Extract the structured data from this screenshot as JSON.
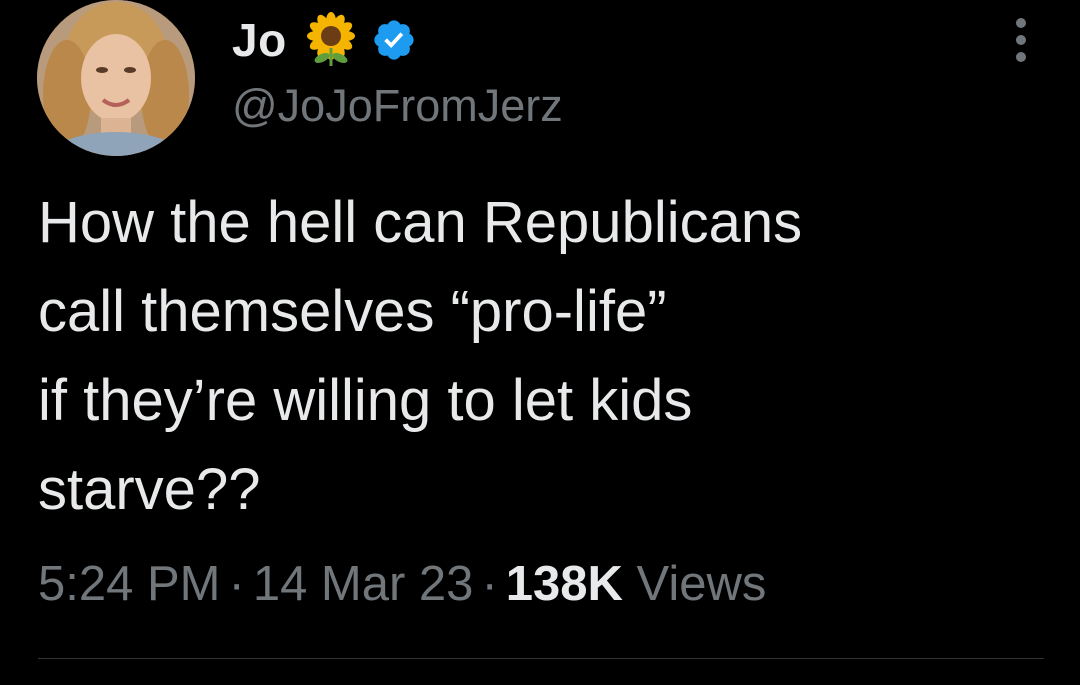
{
  "author": {
    "display_name": "Jo",
    "handle": "@JoJoFromJerz",
    "name_emoji": "sunflower-icon",
    "verified_color": "#1d9bf0"
  },
  "tweet": {
    "lines": [
      "How the hell can Republicans",
      "call themselves “pro-life”",
      "if they’re willing to let kids",
      "starve??"
    ]
  },
  "meta": {
    "time": "5:24 PM",
    "separator": "·",
    "date": "14 Mar 23",
    "views_count": "138K",
    "views_label": "Views"
  },
  "colors": {
    "background": "#000000",
    "text_primary": "#e7e9ea",
    "text_secondary": "#71767b"
  }
}
